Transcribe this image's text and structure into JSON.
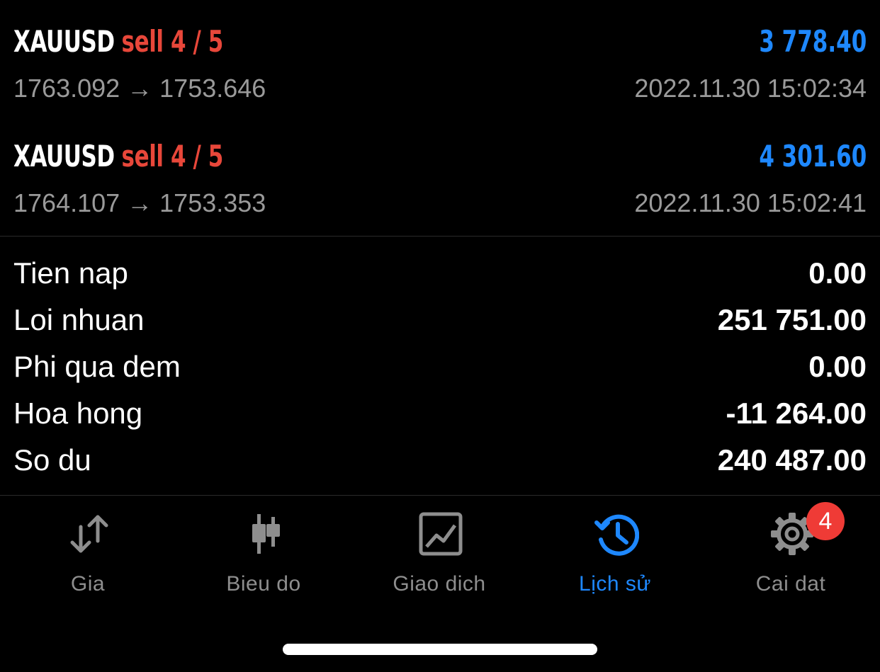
{
  "deals": [
    {
      "symbol": "XAUUSD",
      "side": "sell 4 / 5",
      "profit": "3 778.40",
      "prices": "1763.092 → 1753.646",
      "time": "2022.11.30 15:02:34"
    },
    {
      "symbol": "XAUUSD",
      "side": "sell 4 / 5",
      "profit": "4 301.60",
      "prices": "1764.107 → 1753.353",
      "time": "2022.11.30 15:02:41"
    }
  ],
  "summary": [
    {
      "label": "Tien nap",
      "value": "0.00"
    },
    {
      "label": "Loi nhuan",
      "value": "251 751.00"
    },
    {
      "label": "Phi qua dem",
      "value": "0.00"
    },
    {
      "label": "Hoa hong",
      "value": "-11 264.00"
    },
    {
      "label": "So du",
      "value": "240 487.00"
    }
  ],
  "tabs": [
    {
      "label": "Gia",
      "icon": "arrows-up-down-icon",
      "active": false
    },
    {
      "label": "Bieu do",
      "icon": "candlestick-icon",
      "active": false
    },
    {
      "label": "Giao dich",
      "icon": "trade-chart-icon",
      "active": false
    },
    {
      "label": "Lịch sử",
      "icon": "history-clock-icon",
      "active": true
    },
    {
      "label": "Cai dat",
      "icon": "gear-icon",
      "active": false,
      "badge": "4"
    }
  ],
  "colors": {
    "background": "#000000",
    "sell": "#e8473a",
    "profit": "#1e88ff",
    "secondary_text": "#9a9a9a",
    "tab_inactive": "#8e8e8e",
    "tab_active": "#1e88ff",
    "badge": "#ef3b36"
  }
}
